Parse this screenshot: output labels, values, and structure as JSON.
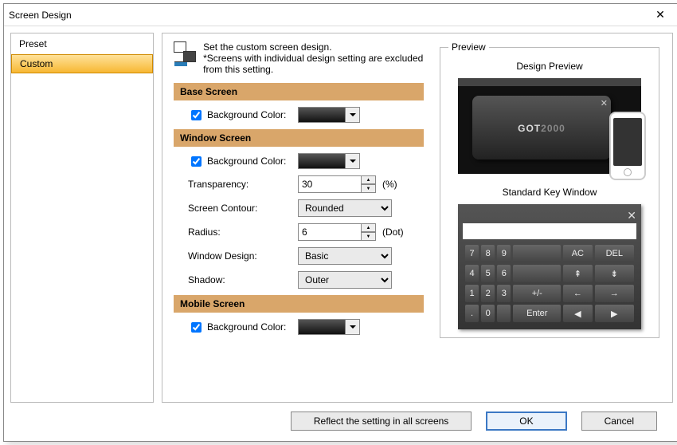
{
  "window": {
    "title": "Screen Design"
  },
  "sidebar": {
    "header": "Preset",
    "items": [
      {
        "label": "Custom",
        "selected": true
      }
    ]
  },
  "intro": {
    "line1": "Set the custom screen design.",
    "line2": "*Screens with individual design setting are excluded from this setting."
  },
  "sections": {
    "base": {
      "title": "Base Screen",
      "bg_color": {
        "label": "Background Color:",
        "checked": true,
        "value": "#2a2a2a"
      }
    },
    "window": {
      "title": "Window Screen",
      "bg_color": {
        "label": "Background Color:",
        "checked": true,
        "value": "#3a3a3a"
      },
      "transparency": {
        "label": "Transparency:",
        "value": "30",
        "unit": "(%)"
      },
      "contour": {
        "label": "Screen Contour:",
        "value": "Rounded"
      },
      "radius": {
        "label": "Radius:",
        "value": "6",
        "unit": "(Dot)"
      },
      "design": {
        "label": "Window Design:",
        "value": "Basic"
      },
      "shadow": {
        "label": "Shadow:",
        "value": "Outer"
      }
    },
    "mobile": {
      "title": "Mobile Screen",
      "bg_color": {
        "label": "Background Color:",
        "checked": true,
        "value": "#2a2a2a"
      }
    }
  },
  "preview": {
    "legend": "Preview",
    "design_title": "Design Preview",
    "logo_a": "GOT",
    "logo_b": "2000",
    "key_title": "Standard Key Window",
    "keys": {
      "r1": [
        "7",
        "8",
        "9",
        "",
        "AC",
        "DEL"
      ],
      "r2": [
        "4",
        "5",
        "6",
        "",
        "⇞",
        "⇟"
      ],
      "r3": [
        "1",
        "2",
        "3",
        "+/-",
        "←",
        "→"
      ],
      "r4": [
        ".",
        "0",
        "",
        "Enter",
        "◀",
        "▶"
      ]
    }
  },
  "buttons": {
    "reflect": "Reflect the setting in all screens",
    "ok": "OK",
    "cancel": "Cancel"
  }
}
